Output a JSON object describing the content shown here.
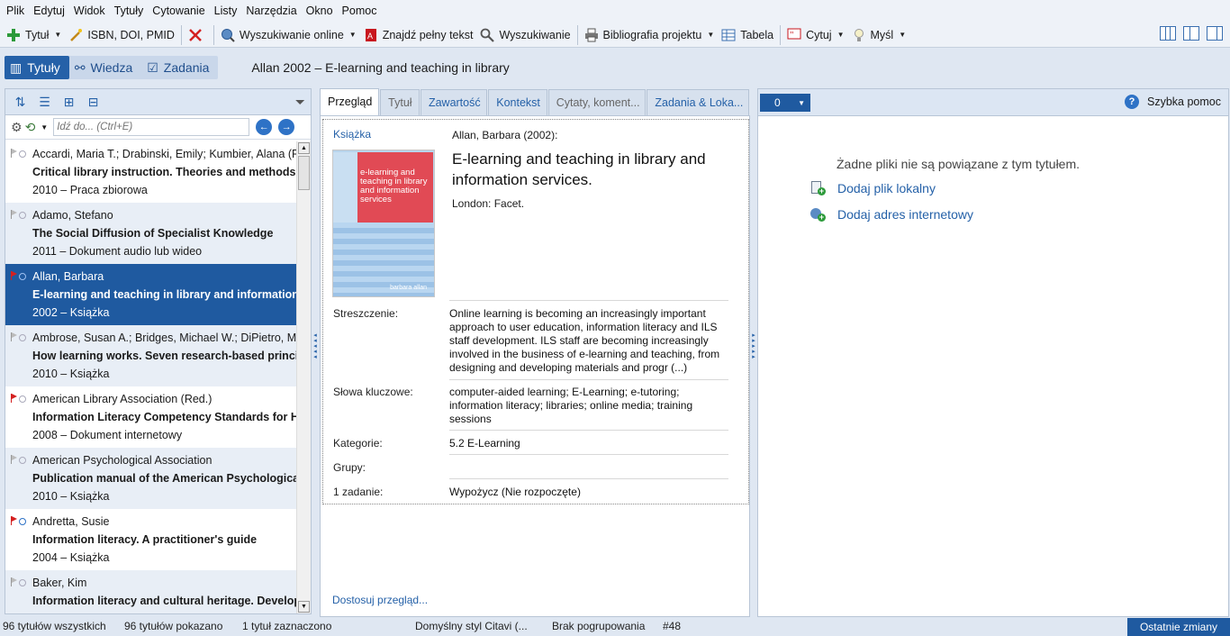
{
  "menu": [
    "Plik",
    "Edytuj",
    "Widok",
    "Tytuły",
    "Cytowanie",
    "Listy",
    "Narzędzia",
    "Okno",
    "Pomoc"
  ],
  "toolbar": {
    "add_title": "Tytuł",
    "isbn": "ISBN, DOI, PMID",
    "online_search": "Wyszukiwanie online",
    "full_text": "Znajdź pełny tekst",
    "search": "Wyszukiwanie",
    "bibliography": "Bibliografia projektu",
    "table": "Tabela",
    "quote": "Cytuj",
    "thought": "Myśl"
  },
  "modes": [
    "Tytuły",
    "Wiedza",
    "Zadania"
  ],
  "document_title": "Allan 2002 – E-learning and teaching in library",
  "search": {
    "placeholder": "Idź do... (Ctrl+E)"
  },
  "references": [
    {
      "authors": "Accardi, Maria T.; Drabinski, Emily; Kumbier, Alana (Re",
      "title": "Critical library instruction. Theories and methods",
      "meta": "2010 – Praca zbiorowa",
      "flag": "gray",
      "dot": "gray"
    },
    {
      "authors": "Adamo, Stefano",
      "title": "The Social Diffusion of Specialist Knowledge",
      "meta": "2011 – Dokument audio lub wideo",
      "flag": "gray",
      "dot": "gray"
    },
    {
      "authors": "Allan, Barbara",
      "title": "E-learning and teaching in library and information se",
      "meta": "2002 – Książka",
      "flag": "red",
      "dot": "blue",
      "selected": true
    },
    {
      "authors": "Ambrose, Susan A.; Bridges, Michael W.; DiPietro, Mic",
      "title": "How learning works. Seven research-based principle",
      "meta": "2010 – Książka",
      "flag": "gray",
      "dot": "gray"
    },
    {
      "authors": "American Library Association (Red.)",
      "title": "Information Literacy Competency Standards for Hig",
      "meta": "2008 – Dokument internetowy",
      "flag": "red",
      "dot": "gray"
    },
    {
      "authors": "American Psychological Association",
      "title": "Publication manual of the American Psychological As",
      "meta": "2010 – Książka",
      "flag": "gray",
      "dot": "gray"
    },
    {
      "authors": "Andretta, Susie",
      "title": "Information literacy. A practitioner's guide",
      "meta": "2004 – Książka",
      "flag": "red",
      "dot": "blue"
    },
    {
      "authors": "Baker, Kim",
      "title": "Information literacy and cultural heritage. Developin",
      "meta": "",
      "flag": "gray",
      "dot": "gray"
    }
  ],
  "tabs": [
    "Przegląd",
    "Tytuł",
    "Zawartość",
    "Kontekst",
    "Cytaty,  koment...",
    "Zadania & Loka..."
  ],
  "overview": {
    "type": "Książka",
    "author_line": "Allan, Barbara (2002):",
    "title": "E-learning and teaching in library and information services.",
    "place": "London: Facet.",
    "cover_text": "e-learning and teaching in library and information services",
    "cover_author": "barbara allan",
    "abstract_label": "Streszczenie:",
    "abstract": "Online learning is becoming an increasingly important approach to user education, information literacy and ILS staff development. ILS staff are becoming increasingly involved in the business of e-learning and teaching, from designing and developing materials and progr (...)",
    "keywords_label": "Słowa kluczowe:",
    "keywords": "computer-aided learning; E-Learning; e-tutoring; information literacy; libraries; online media; training sessions",
    "categories_label": "Kategorie:",
    "categories": "5.2 E-Learning",
    "groups_label": "Grupy:",
    "groups": "",
    "tasks_label": "1 zadanie:",
    "tasks": "Wypożycz (Nie rozpoczęte)",
    "customize": "Dostosuj przegląd..."
  },
  "right": {
    "count": "0",
    "help": "Szybka pomoc",
    "no_files": "Żadne pliki nie są powiązane z tym tytułem.",
    "add_local": "Dodaj plik lokalny",
    "add_url": "Dodaj adres internetowy"
  },
  "status": {
    "total": "96 tytułów wszystkich",
    "shown": "96 tytułów pokazano",
    "selected": "1 tytuł zaznaczono",
    "style": "Domyślny styl Citavi (...",
    "grouping": "Brak pogrupowania",
    "number": "#48",
    "recent": "Ostatnie zmiany"
  },
  "colors": {
    "accent": "#1f5aa0",
    "flag_red": "#d42020",
    "link": "#2561a8"
  }
}
